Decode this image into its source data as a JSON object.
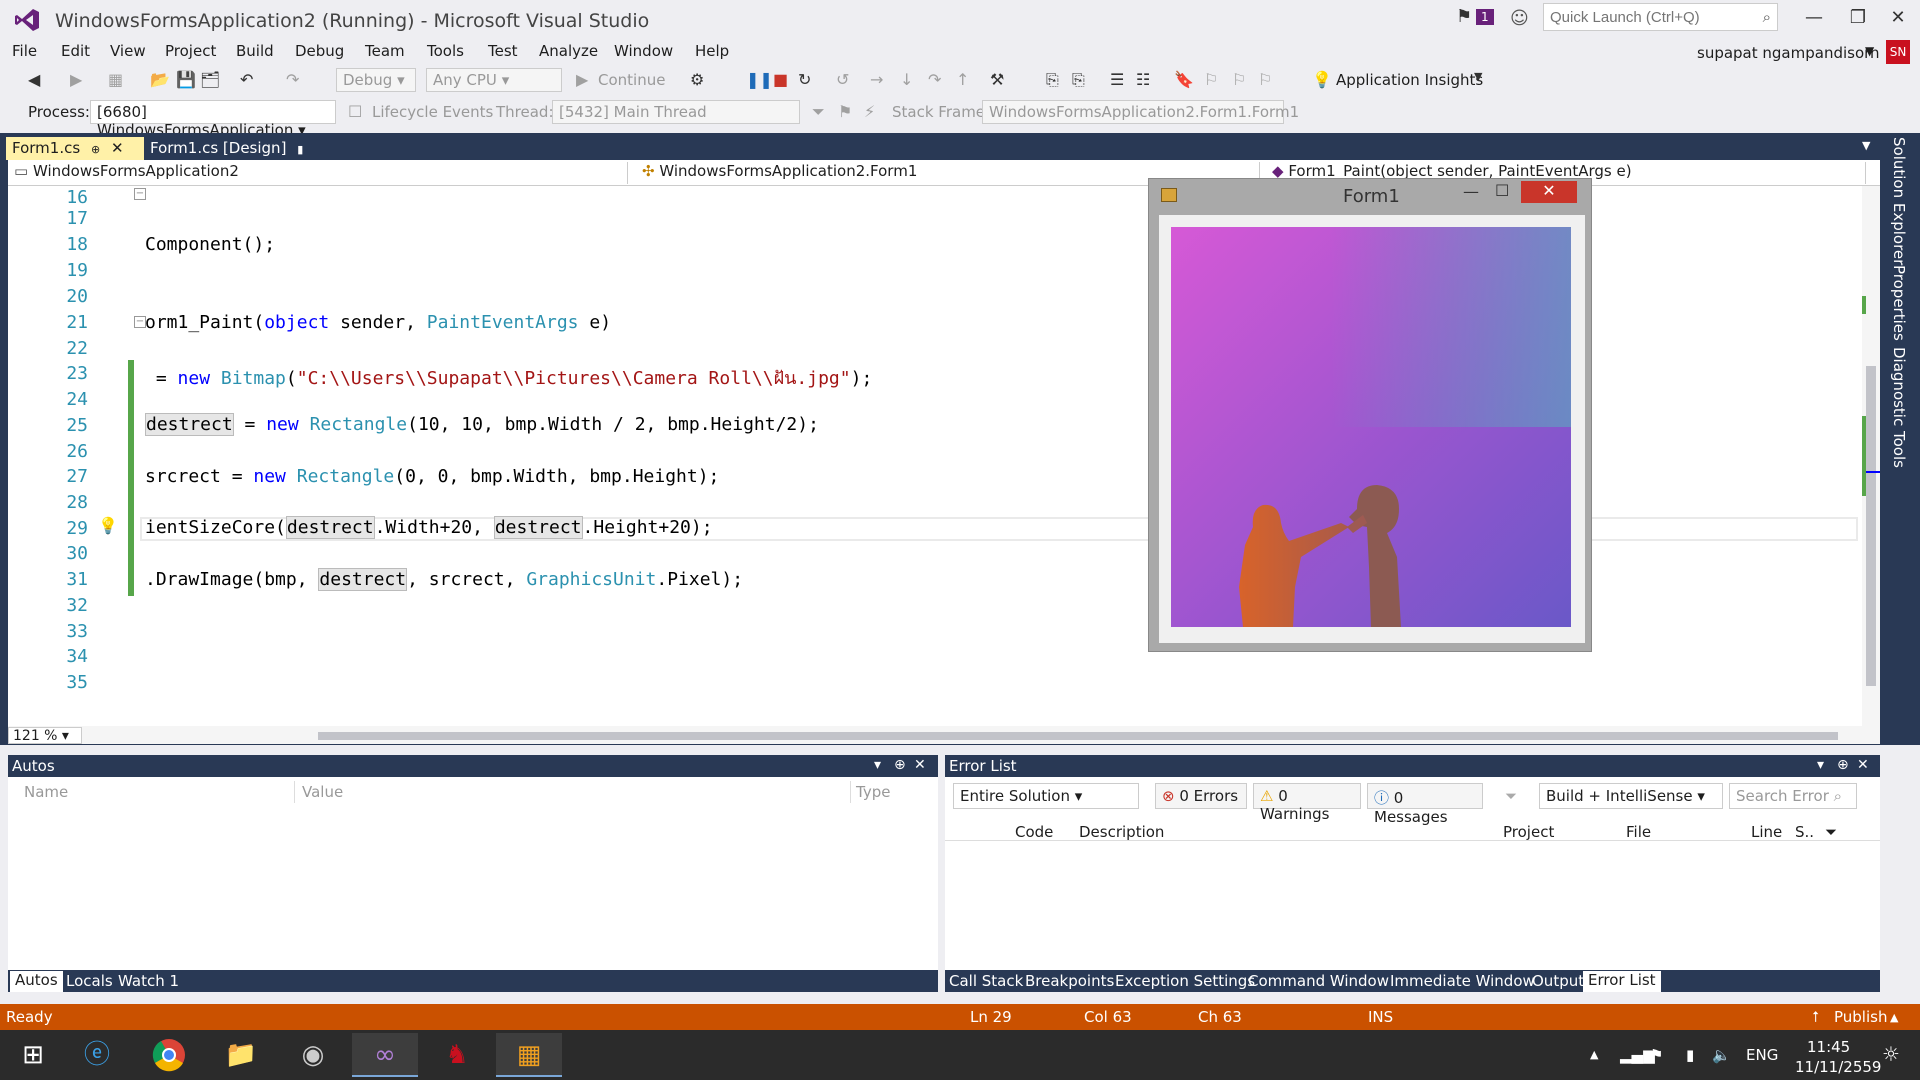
{
  "app": {
    "title": "WindowsFormsApplication2 (Running) - Microsoft Visual Studio",
    "notification_count": "1",
    "quick_launch_placeholder": "Quick Launch (Ctrl+Q)",
    "user_name": "supapat ngampandisorn",
    "user_initials": "SN"
  },
  "menu": [
    "File",
    "Edit",
    "View",
    "Project",
    "Build",
    "Debug",
    "Team",
    "Tools",
    "Test",
    "Analyze",
    "Window",
    "Help"
  ],
  "toolbar": {
    "config": "Debug",
    "platform": "Any CPU",
    "continue_label": "Continue",
    "app_insights": "Application Insights",
    "process_label": "Process:",
    "process_value": "[6680] WindowsFormsApplication",
    "lifecycle_label": "Lifecycle Events",
    "thread_label": "Thread:",
    "thread_value": "[5432] Main Thread",
    "stack_label": "Stack Frame:",
    "stack_value": "WindowsFormsApplication2.Form1.Form1"
  },
  "tabs": [
    {
      "label": "Form1.cs",
      "active": true
    },
    {
      "label": "Form1.cs [Design]",
      "active": false
    }
  ],
  "nav": {
    "project": "WindowsFormsApplication2",
    "type": "WindowsFormsApplication2.Form1",
    "member": "Form1_Paint(object sender, PaintEventArgs e)"
  },
  "editor": {
    "zoom": "121 %",
    "lines": [
      "16",
      "17",
      "18",
      "19",
      "20",
      "21",
      "22",
      "23",
      "24",
      "25",
      "26",
      "27",
      "28",
      "29",
      "30",
      "31",
      "32",
      "33",
      "34",
      "35"
    ],
    "code": {
      "l18": "Component();",
      "l21a": "orm1_Paint(",
      "l21b": "object",
      "l21c": " sender, ",
      "l21d": "PaintEventArgs",
      "l21e": " e)",
      "l23a": " = ",
      "l23b": "new",
      "l23c": " ",
      "l23d": "Bitmap",
      "l23e": "(",
      "l23f": "\"C:\\\\Users\\\\Supapat\\\\Pictures\\\\Camera Roll\\\\ฝัน.jpg\"",
      "l23g": ");",
      "l25a": "destrect",
      "l25b": " = ",
      "l25c": "new",
      "l25d": " ",
      "l25e": "Rectangle",
      "l25f": "(10, 10, bmp.Width / 2, bmp.Height/2);",
      "l27a": "srcrect = ",
      "l27b": "new",
      "l27c": " ",
      "l27d": "Rectangle",
      "l27e": "(0, 0, bmp.Width, bmp.Height);",
      "l29a": "ientSizeCore(",
      "l29b": "destrect",
      "l29c": ".Width+20, ",
      "l29d": "destrect",
      "l29e": ".Height+20);",
      "l31a": ".DrawImage(bmp, ",
      "l31b": "destrect",
      "l31c": ", srcrect, ",
      "l31d": "GraphicsUnit",
      "l31e": ".Pixel);"
    }
  },
  "side_tabs": [
    "Solution Explorer",
    "Properties",
    "Diagnostic Tools"
  ],
  "form1": {
    "title": "Form1"
  },
  "autos": {
    "title": "Autos",
    "columns": [
      "Name",
      "Value",
      "Type"
    ],
    "tabs": [
      "Autos",
      "Locals",
      "Watch 1"
    ]
  },
  "error_list": {
    "title": "Error List",
    "scope": "Entire Solution",
    "errors": "0 Errors",
    "warnings": "0 Warnings",
    "messages": "0 Messages",
    "build_filter": "Build + IntelliSense",
    "search_placeholder": "Search Error",
    "columns": [
      "Code",
      "Description",
      "Project",
      "File",
      "Line",
      "S.."
    ],
    "tabs": [
      "Call Stack",
      "Breakpoints",
      "Exception Settings",
      "Command Window",
      "Immediate Window",
      "Output",
      "Error List"
    ]
  },
  "status": {
    "ready": "Ready",
    "ln": "Ln 29",
    "col": "Col 63",
    "ch": "Ch 63",
    "ins": "INS",
    "publish": "Publish"
  },
  "taskbar": {
    "lang": "ENG",
    "time": "11:45",
    "date": "11/11/2559"
  },
  "colors": {
    "accent_vs": "#68217a",
    "status_orange": "#ca5100",
    "panel_header": "#293955"
  }
}
